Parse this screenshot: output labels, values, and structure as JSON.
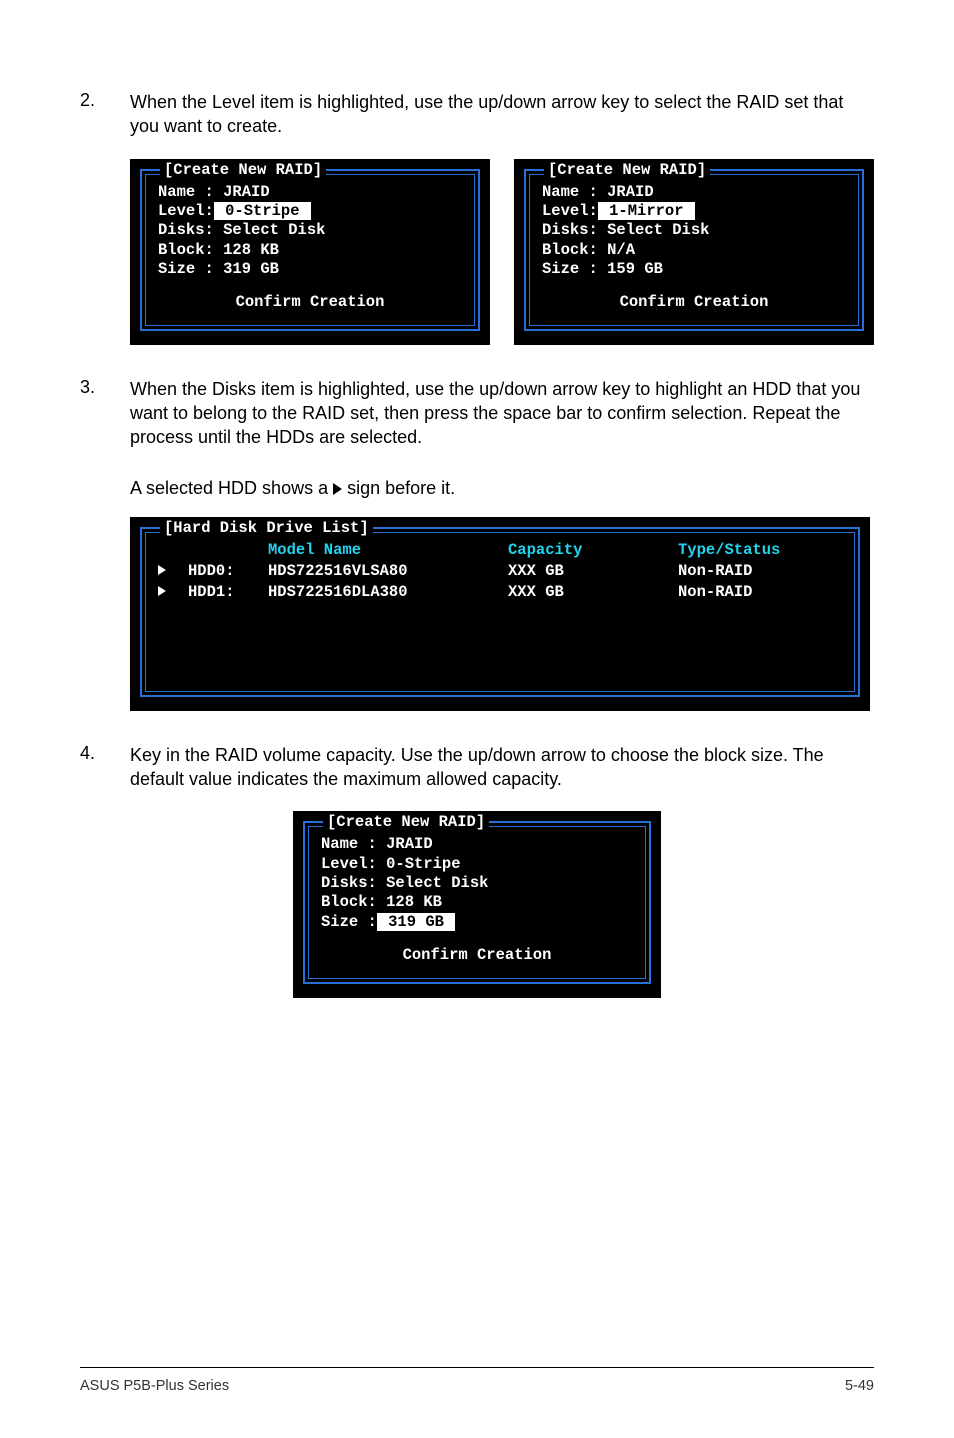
{
  "step2": {
    "num": "2.",
    "text": "When the Level item is highlighted, use the up/down arrow key to select the RAID set that you want to create."
  },
  "panelA": {
    "title": "[Create New RAID]",
    "rows": {
      "name_lbl": "Name :",
      "name_val": "JRAID",
      "level_lbl": "Level:",
      "level_val": " 0-Stripe ",
      "disks_lbl": "Disks:",
      "disks_val": "Select Disk",
      "block_lbl": "Block:",
      "block_val": "128 KB",
      "size_lbl": "Size :",
      "size_val": "319 GB"
    },
    "confirm": "Confirm Creation"
  },
  "panelB": {
    "title": "[Create New RAID]",
    "rows": {
      "name_lbl": "Name :",
      "name_val": "JRAID",
      "level_lbl": "Level:",
      "level_val": " 1-Mirror ",
      "disks_lbl": "Disks:",
      "disks_val": "Select Disk",
      "block_lbl": "Block:",
      "block_val": "N/A",
      "size_lbl": "Size :",
      "size_val": "159 GB"
    },
    "confirm": "Confirm Creation"
  },
  "step3": {
    "num": "3.",
    "text": "When the Disks item is highlighted, use the up/down arrow key to highlight an HDD that you want to belong to the RAID set, then press the space bar to confirm selection. Repeat the process until the HDDs are selected.",
    "sub": "A selected HDD shows a     sign before it."
  },
  "diskPanel": {
    "title": "[Hard Disk Drive List]",
    "head": {
      "model": "Model Name",
      "cap": "Capacity",
      "type": "Type/Status"
    },
    "rows": [
      {
        "id": "HDD0:",
        "model": "HDS722516VLSA80",
        "cap": "XXX GB",
        "type": "Non-RAID"
      },
      {
        "id": "HDD1:",
        "model": "HDS722516DLA380",
        "cap": "XXX GB",
        "type": "Non-RAID"
      }
    ]
  },
  "step4": {
    "num": "4.",
    "text": "Key in the RAID volume capacity. Use the up/down arrow to choose the block size. The default value indicates the maximum allowed capacity."
  },
  "panelC": {
    "title": "[Create New RAID]",
    "rows": {
      "name_lbl": "Name :",
      "name_val": "JRAID",
      "level_lbl": "Level:",
      "level_val": "0-Stripe",
      "disks_lbl": "Disks:",
      "disks_val": "Select Disk",
      "block_lbl": "Block:",
      "block_val": "128 KB",
      "size_lbl": "Size :",
      "size_val": " 319 GB "
    },
    "confirm": "Confirm Creation"
  },
  "footer": {
    "left": "ASUS P5B-Plus Series",
    "right": "5-49"
  }
}
